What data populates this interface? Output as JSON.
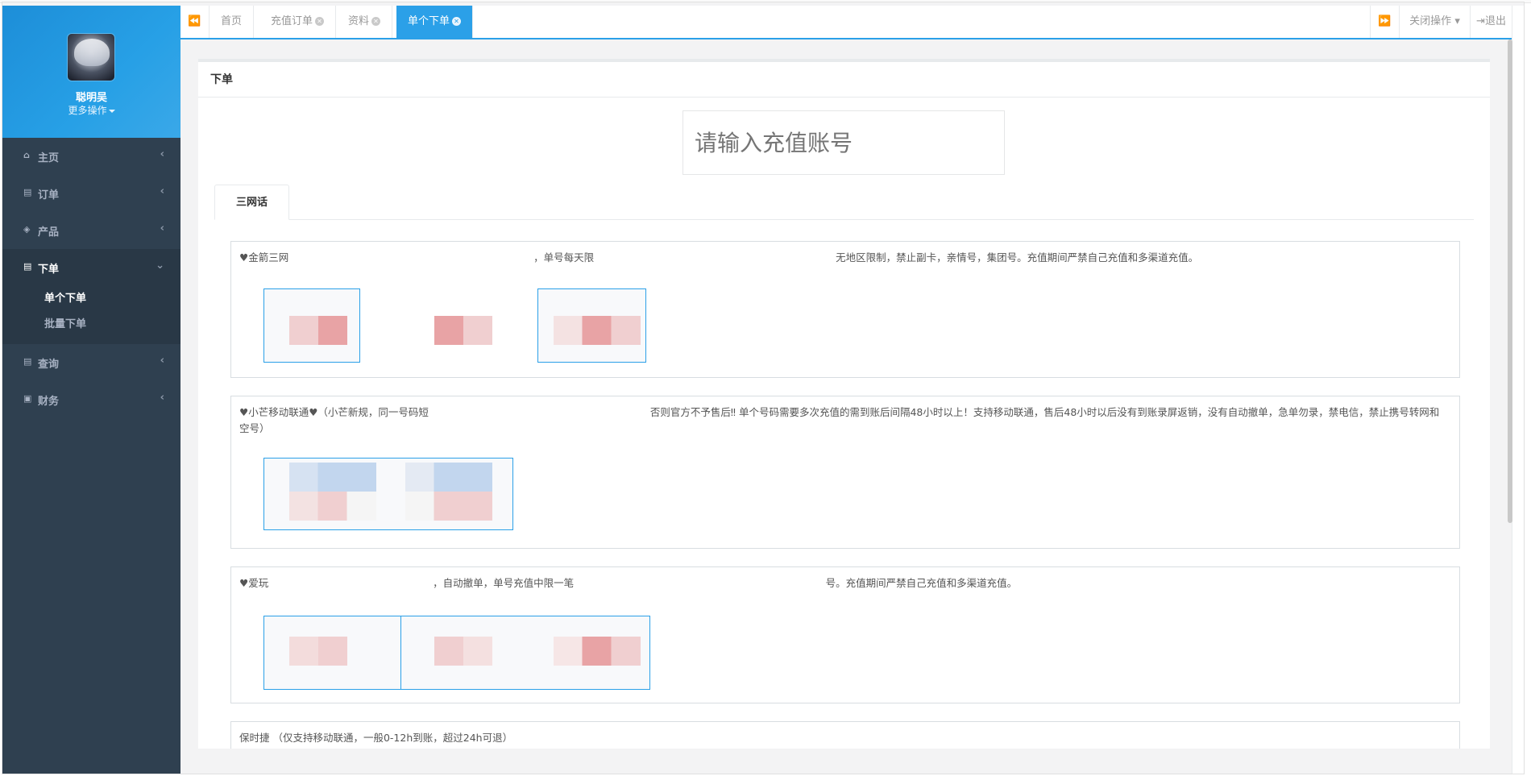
{
  "profile": {
    "username": "聪明吴",
    "more_ops": "更多操作"
  },
  "menu": [
    {
      "label": "主页",
      "icon": "home-icon",
      "glyph": "⌂",
      "arrow": "‹"
    },
    {
      "label": "订单",
      "icon": "file-icon",
      "glyph": "▤",
      "arrow": "‹"
    },
    {
      "label": "产品",
      "icon": "cube-icon",
      "glyph": "◈",
      "arrow": "‹"
    },
    {
      "label": "下单",
      "icon": "file-text-icon",
      "glyph": "▤",
      "arrow": "⌄"
    },
    {
      "label": "查询",
      "icon": "file-icon",
      "glyph": "▤",
      "arrow": "‹"
    },
    {
      "label": "财务",
      "icon": "money-icon",
      "glyph": "▣",
      "arrow": "‹"
    }
  ],
  "submenu": [
    "单个下单",
    "批量下单"
  ],
  "tabs": {
    "prev": "⏪",
    "next": "⏩",
    "items": [
      "首页",
      "充值订单",
      "资料",
      "单个下单"
    ],
    "close_glyph": "✕",
    "close_ops": "关闭操作",
    "logout": "退出"
  },
  "panel": {
    "title": "下单",
    "account_placeholder": "请输入充值账号",
    "subtab": "三网话"
  },
  "groups": [
    {
      "desc": "♥金箭三网 　　　　　　　　　　　　　　　　　　　　　　　　，单号每天限　　　　　　　　　　　　　　　　　　　　　　　　无地区限制，禁止副卡，亲情号，集团号。充值期间严禁自己充值和多渠道充值。"
    },
    {
      "desc": "♥小芒移动联通♥（小芒新规，同一号码短　　　　　　　　　　　　　　　　　　　　　　否则官方不予售后‼ 单个号码需要多次充值的需到账后间隔48小时以上！支持移动联通，售后48小时以后没有到账录屏返销，没有自动撤单，急单勿录，禁电信，禁止携号转网和空号）"
    },
    {
      "desc": "♥爱玩 　　　　　　　　　　　　　　　　，自动撤单，单号充值中限一笔　　　　　　　　　　　　　　　　　　　　　　　　　号。充值期间严禁自己充值和多渠道充值。"
    },
    {
      "desc": "保时捷 （仅支持移动联通，一般0-12h到账，超过24h可退）"
    }
  ],
  "colors": {
    "sidebar": "#2f4050",
    "accent": "#2ba0e8",
    "content_bg": "#f3f3f4"
  }
}
